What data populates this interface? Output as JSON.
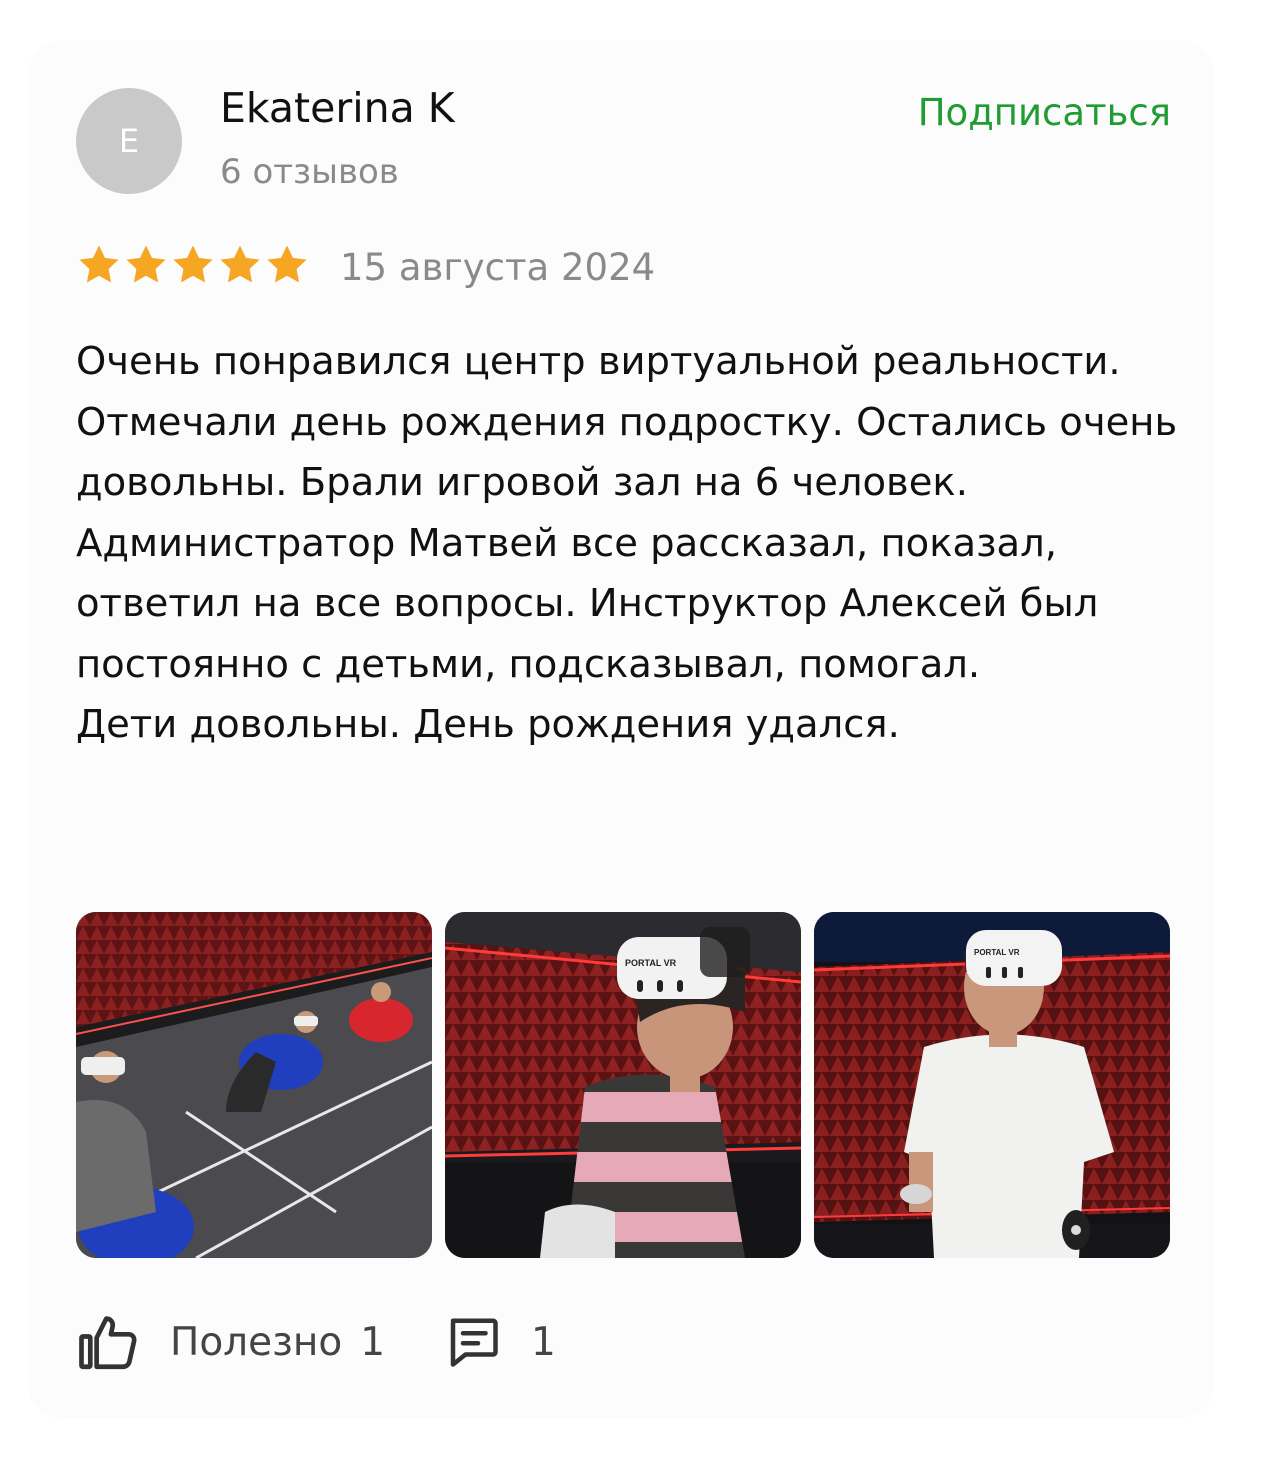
{
  "author": {
    "initial": "E",
    "name": "Ekaterina K",
    "reviews_count": "6 отзывов"
  },
  "subscribe_label": "Подписаться",
  "rating": {
    "stars": 5,
    "max": 5,
    "color": "#f5a623"
  },
  "date": "15 августа 2024",
  "body": [
    "Очень понравился центр виртуальной реальности.",
    "Отмечали день рождения подростку. Остались очень довольны. Брали игровой зал на 6 человек. Администратор Матвей все рассказал, показал, ответил на все вопросы. Инструктор Алексей был постоянно с детьми, подсказывал, помогал.",
    "Дети довольны. День рождения удался."
  ],
  "photos": [
    {
      "name": "photo-kids-beanbags",
      "headset_text": ""
    },
    {
      "name": "photo-boy-striped-sweater",
      "headset_text": "PORTAL VR"
    },
    {
      "name": "photo-boy-white-tshirt",
      "headset_text": "PORTAL VR"
    }
  ],
  "actions": {
    "useful_label": "Полезно",
    "useful_count": "1",
    "comments_count": "1"
  },
  "colors": {
    "accent_green": "#1f9c32",
    "muted_text": "#8a8a8a",
    "avatar_bg": "#c9c9c9"
  }
}
